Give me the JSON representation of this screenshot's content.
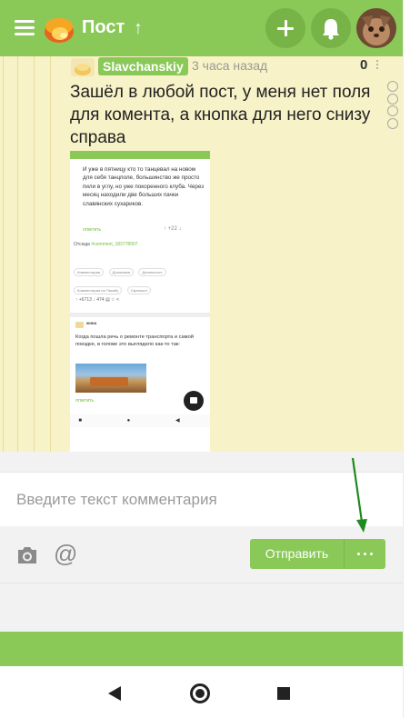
{
  "header": {
    "title": "Пост",
    "up_arrow": "↑",
    "colors": {
      "bar": "#8ac858",
      "circle": "#78b347"
    }
  },
  "comment": {
    "author": "Slavchanskiy",
    "time": "3 часа назад",
    "rating": "0",
    "text": "Зашёл в любой пост, у меня нет поля для комента, а кнопка для него снизу справа",
    "embedded_screenshot": {
      "body": "И уже в пятницу кто то танцевал на новом для себя танцполе, большинство же просто пили в углу, но уже покоренного клуба. Через месяц находили две больших пачки славянских сухариков.",
      "reply": "ответить",
      "votes": "↑ +22 ↓",
      "from_label": "Отсюда",
      "from_link": "#comment_183778907",
      "tags": [
        "Комментарии",
        "Доказанка",
        "Длиннопост",
        "Комментарии на Пикабу",
        "Скриншот"
      ],
      "actions": "↑ +6713 ↓   474 ▤   ☆   <",
      "comment2_author": "жнна",
      "comment2_text": "Когда пошла речь о ремонте транспорта и самой поездке, в голове это выглядело как-то так:",
      "comment2_reply": "ответить",
      "nav": "■ ● ◀"
    }
  },
  "composer": {
    "placeholder": "Введите текст комментария",
    "at_symbol": "@",
    "send_label": "Отправить"
  },
  "icons": {
    "menu": "hamburger-icon",
    "logo": "pikabu-logo",
    "plus": "plus-icon",
    "bell": "bell-icon",
    "camera": "camera-icon",
    "at": "at-icon",
    "more": "more-dots-icon",
    "back": "back-icon",
    "home": "home-icon",
    "recent": "recent-apps-icon"
  }
}
